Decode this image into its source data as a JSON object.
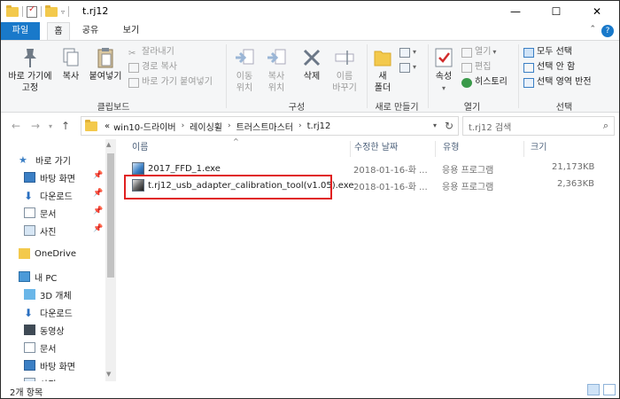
{
  "window": {
    "title": "t.rj12"
  },
  "colors": {
    "accent": "#1979ca",
    "highlight_box": "#e02020",
    "folder": "#f3c94c"
  },
  "tabs": [
    {
      "label": "파일"
    },
    {
      "label": "홈"
    },
    {
      "label": "공유"
    },
    {
      "label": "보기"
    }
  ],
  "ribbon": {
    "clipboard": {
      "pin_label_1": "바로 가기에",
      "pin_label_2": "고정",
      "copy_label": "복사",
      "paste_label": "붙여넣기",
      "cut_label": "잘라내기",
      "copy_path_label": "경로 복사",
      "paste_shortcut_label": "바로 가기 붙여넣기",
      "group_label": "클립보드"
    },
    "organize": {
      "move_label_1": "이동",
      "move_label_2": "위치",
      "copyto_label_1": "복사",
      "copyto_label_2": "위치",
      "delete_label": "삭제",
      "rename_label_1": "이름",
      "rename_label_2": "바꾸기",
      "group_label": "구성"
    },
    "new": {
      "newfolder_label_1": "새",
      "newfolder_label_2": "폴더",
      "group_label": "새로 만들기"
    },
    "open": {
      "properties_label": "속성",
      "open_label": "열기",
      "edit_label": "편집",
      "history_label": "히스토리",
      "group_label": "열기"
    },
    "select": {
      "select_all_label": "모두 선택",
      "select_none_label": "선택 안 함",
      "invert_label": "선택 영역 반전",
      "group_label": "선택"
    }
  },
  "address": {
    "lead": "«",
    "crumbs": [
      "win10-드라이버",
      "레이싱휠",
      "트러스트마스터",
      "t.rj12"
    ],
    "search_placeholder": "t.rj12 검색"
  },
  "nav": {
    "quick_access": "바로 가기",
    "items": [
      {
        "label": "바탕 화면"
      },
      {
        "label": "다운로드"
      },
      {
        "label": "문서"
      },
      {
        "label": "사진"
      }
    ],
    "onedrive": "OneDrive",
    "this_pc": "내 PC",
    "pc_items": [
      {
        "label": "3D 개체"
      },
      {
        "label": "다운로드"
      },
      {
        "label": "동영상"
      },
      {
        "label": "문서"
      },
      {
        "label": "바탕 화면"
      },
      {
        "label": "사진"
      }
    ]
  },
  "columns": {
    "name": "이름",
    "modified": "수정한 날짜",
    "type": "유형",
    "size": "크기"
  },
  "files": [
    {
      "name": "2017_FFD_1.exe",
      "modified": "2018-01-16-화 ...",
      "type": "응용 프로그램",
      "size": "21,173KB"
    },
    {
      "name": "t.rj12_usb_adapter_calibration_tool(v1.05).exe",
      "modified": "2018-01-16-화 ...",
      "type": "응용 프로그램",
      "size": "2,363KB"
    }
  ],
  "status": {
    "item_count": "2개 항목"
  }
}
